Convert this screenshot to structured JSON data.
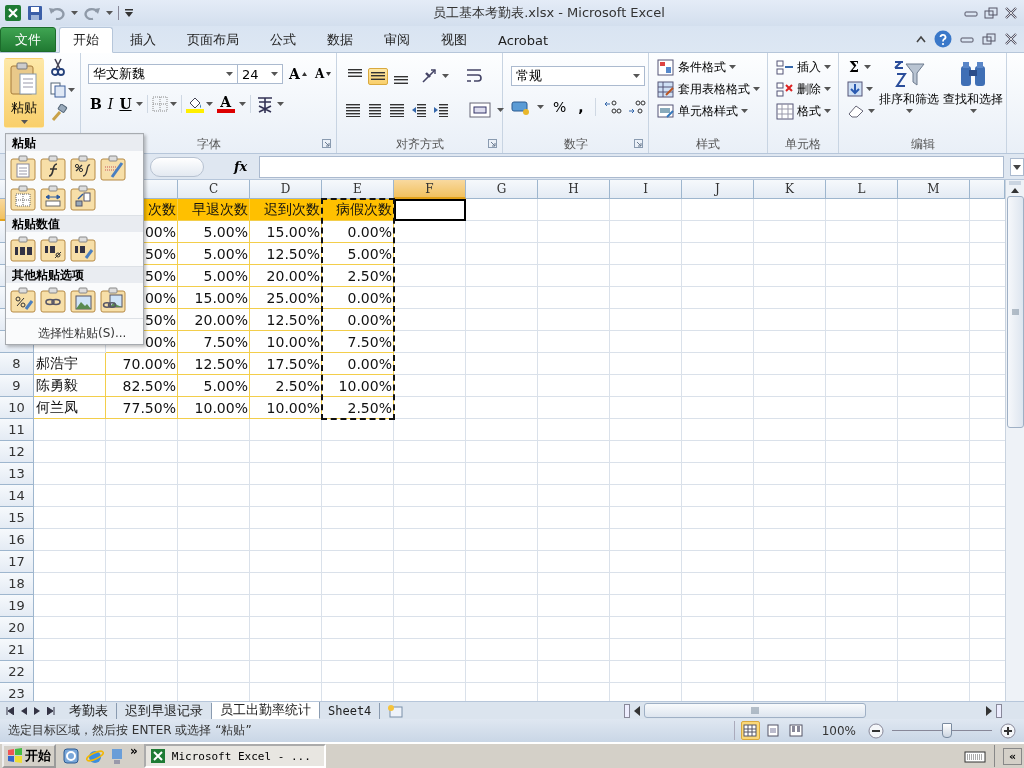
{
  "window": {
    "title": "员工基本考勤表.xlsx - Microsoft Excel"
  },
  "ribbon_tabs": [
    {
      "label": "文件",
      "kind": "file",
      "selected": false
    },
    {
      "label": "开始",
      "kind": "tab",
      "selected": true
    },
    {
      "label": "插入",
      "kind": "tab",
      "selected": false
    },
    {
      "label": "页面布局",
      "kind": "tab",
      "selected": false
    },
    {
      "label": "公式",
      "kind": "tab",
      "selected": false
    },
    {
      "label": "数据",
      "kind": "tab",
      "selected": false
    },
    {
      "label": "审阅",
      "kind": "tab",
      "selected": false
    },
    {
      "label": "视图",
      "kind": "tab",
      "selected": false
    },
    {
      "label": "Acrobat",
      "kind": "tab",
      "selected": false
    }
  ],
  "clipboard": {
    "paste_label": "粘贴",
    "pressed": true
  },
  "font_group": {
    "label": "字体",
    "launcher": true,
    "font_name": "华文新魏",
    "font_size": "24",
    "grow": "A",
    "shrink": "A",
    "bold": "B",
    "italic": "I",
    "underline": "U",
    "font_color": "A"
  },
  "alignment_group": {
    "label": "对齐方式",
    "launcher": true,
    "vertical": [
      {
        "selected": false
      },
      {
        "selected": true
      },
      {
        "selected": false
      }
    ]
  },
  "number_group": {
    "label": "数字",
    "launcher": true,
    "format": "常规",
    "percent": "%",
    "comma": ","
  },
  "styles_group": {
    "label": "样式",
    "items": [
      "条件格式",
      "套用表格格式",
      "单元格样式"
    ]
  },
  "cells_group": {
    "label": "单元格",
    "items": [
      "插入",
      "删除",
      "格式"
    ]
  },
  "editing_group": {
    "label": "编辑",
    "sum": "Σ",
    "sort": "排序和筛选",
    "find": "查找和选择"
  },
  "formula_bar": {
    "fx": "fx"
  },
  "sheet": {
    "columns": [
      {},
      {
        "selected": false
      },
      {
        "label": "C",
        "selected": false
      },
      {
        "label": "D",
        "selected": false
      },
      {
        "label": "E",
        "selected": false,
        "copied": true
      },
      {
        "label": "F",
        "selected": true
      },
      {
        "label": "G",
        "selected": false
      },
      {
        "label": "H",
        "selected": false
      },
      {
        "label": "I",
        "selected": false
      },
      {
        "label": "J",
        "selected": false
      },
      {
        "label": "K",
        "selected": false
      },
      {
        "label": "L",
        "selected": false
      },
      {
        "label": "M",
        "selected": false
      },
      {
        "selected": false
      }
    ],
    "rows": [
      {
        "kind": "header",
        "selected": true,
        "cells": [
          null,
          "次数",
          "早退次数",
          "迟到次数",
          "病假次数"
        ]
      },
      {
        "kind": "data",
        "selected": false,
        "cells": [
          null,
          "00%",
          "5.00%",
          "15.00%",
          "0.00%"
        ]
      },
      {
        "kind": "data",
        "selected": false,
        "cells": [
          null,
          "50%",
          "5.00%",
          "12.50%",
          "5.00%"
        ]
      },
      {
        "kind": "data",
        "selected": false,
        "cells": [
          null,
          "50%",
          "5.00%",
          "20.00%",
          "2.50%"
        ]
      },
      {
        "kind": "data",
        "selected": false,
        "cells": [
          null,
          "00%",
          "15.00%",
          "25.00%",
          "0.00%"
        ]
      },
      {
        "kind": "data",
        "selected": false,
        "cells": [
          null,
          "50%",
          "20.00%",
          "12.50%",
          "0.00%"
        ]
      },
      {
        "kind": "data",
        "selected": false,
        "cells": [
          null,
          "00%",
          "7.50%",
          "10.00%",
          "7.50%"
        ]
      },
      {
        "kind": "data",
        "number": "8",
        "selected": false,
        "cells": [
          "郝浩宇",
          "70.00%",
          "12.50%",
          "17.50%",
          "0.00%"
        ]
      },
      {
        "kind": "data",
        "number": "9",
        "selected": false,
        "cells": [
          "陈勇毅",
          "82.50%",
          "5.00%",
          "2.50%",
          "10.00%"
        ]
      },
      {
        "kind": "data",
        "number": "10",
        "selected": false,
        "cells": [
          "何兰凤",
          "77.50%",
          "10.00%",
          "10.00%",
          "2.50%"
        ]
      },
      {
        "kind": "empty",
        "number": "11",
        "selected": false
      },
      {
        "kind": "empty",
        "number": "12",
        "selected": false
      },
      {
        "kind": "empty",
        "number": "13",
        "selected": false
      },
      {
        "kind": "empty",
        "number": "14",
        "selected": false
      },
      {
        "kind": "empty",
        "number": "15",
        "selected": false
      },
      {
        "kind": "empty",
        "number": "16",
        "selected": false
      },
      {
        "kind": "empty",
        "number": "17",
        "selected": false
      },
      {
        "kind": "empty",
        "number": "18",
        "selected": false
      },
      {
        "kind": "empty",
        "number": "19",
        "selected": false
      },
      {
        "kind": "empty",
        "number": "20",
        "selected": false
      },
      {
        "kind": "empty",
        "number": "21",
        "selected": false
      },
      {
        "kind": "empty",
        "number": "22",
        "selected": false
      },
      {
        "kind": "empty",
        "number": "23",
        "selected": false
      }
    ]
  },
  "paste_menu": {
    "sections": [
      {
        "title": "粘贴",
        "options": [
          {
            "kind": "paste"
          },
          {
            "kind": "formulas"
          },
          {
            "kind": "formulas_number_format"
          },
          {
            "kind": "keep_source_format"
          },
          {
            "kind": "no_borders"
          },
          {
            "kind": "keep_column_widths"
          },
          {
            "kind": "transpose"
          }
        ]
      },
      {
        "title": "粘贴数值",
        "options": [
          {
            "kind": "values"
          },
          {
            "kind": "values_number_format"
          },
          {
            "kind": "values_source_format"
          }
        ]
      },
      {
        "title": "其他粘贴选项",
        "options": [
          {
            "kind": "formatting"
          },
          {
            "kind": "link"
          },
          {
            "kind": "picture"
          },
          {
            "kind": "linked_picture"
          }
        ]
      }
    ],
    "more": "选择性粘贴(S)..."
  },
  "sheet_tabs": [
    {
      "label": "考勤表",
      "selected": false
    },
    {
      "label": "迟到早退记录",
      "selected": false
    },
    {
      "label": "员工出勤率统计",
      "selected": true
    },
    {
      "label": "Sheet4",
      "selected": false
    }
  ],
  "status_bar": {
    "message": "选定目标区域，然后按 ENTER 或选择 “粘贴”",
    "views": [
      {
        "selected": true
      },
      {
        "selected": false
      },
      {
        "selected": false
      }
    ],
    "zoom": "100%",
    "level": 0.55
  },
  "taskbar": {
    "start": "开始",
    "more": "»",
    "window_button": "Microsoft Excel - ...",
    "collapse": "«"
  }
}
